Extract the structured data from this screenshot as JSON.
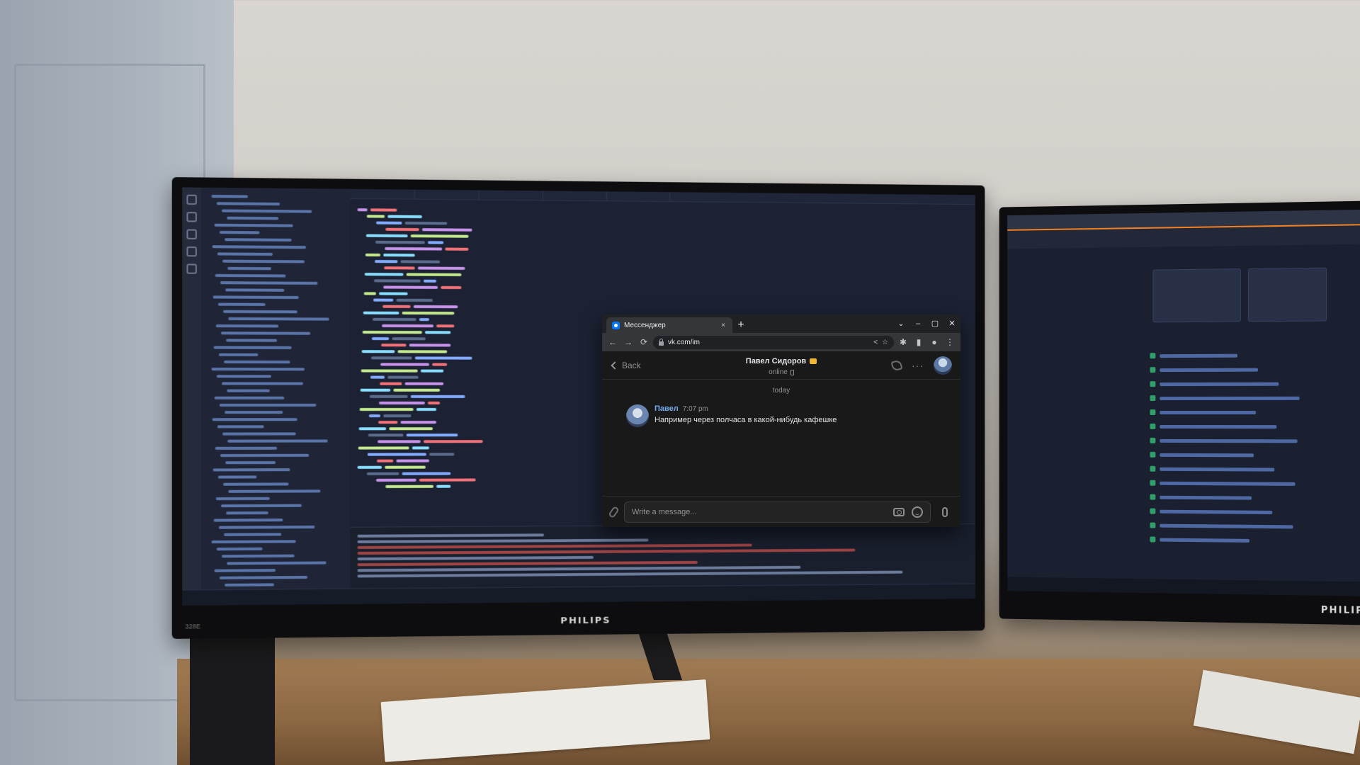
{
  "window": {
    "tab_title": "Мессенджер",
    "tab_close": "×",
    "new_tab": "+",
    "controls": {
      "dropdown": "⌄",
      "minimize": "–",
      "maximize": "▢",
      "close": "✕"
    },
    "url": "vk.com/im",
    "accent_color": "#0077ff"
  },
  "nav": {
    "back_arrow": "←",
    "forward_arrow": "→",
    "reload": "⟳"
  },
  "vk": {
    "back_label": "Back",
    "peer_name": "Павел Сидоров",
    "peer_status": "online",
    "day_separator": "today",
    "messages": [
      {
        "author": "Павел",
        "time": "7:07 pm",
        "text": "Например через полчаса в какой-нибудь кафешке"
      }
    ],
    "composer_placeholder": "Write a message...",
    "more_icon": "···"
  },
  "monitors": {
    "left_brand": "PHILIPS",
    "right_brand": "PHILIPS",
    "model": "328E"
  }
}
